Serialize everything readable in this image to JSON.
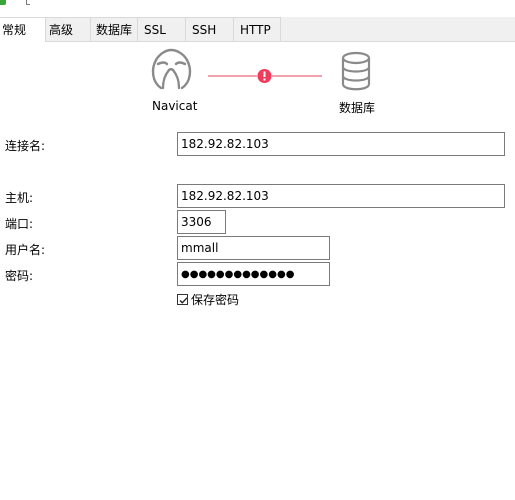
{
  "tabs": [
    {
      "label": "常规",
      "active": true
    },
    {
      "label": "高级",
      "active": false
    },
    {
      "label": "数据库",
      "active": false
    },
    {
      "label": "SSL",
      "active": false
    },
    {
      "label": "SSH",
      "active": false
    },
    {
      "label": "HTTP",
      "active": false
    }
  ],
  "graphic": {
    "client_label": "Navicat",
    "server_label": "数据库",
    "client_icon": "navicat-logo-icon",
    "server_icon": "database-icon",
    "status_icon": "error-icon",
    "link_color": "#f4a0ad",
    "status_color": "#ef3b5c"
  },
  "form": {
    "connection_name": {
      "label": "连接名:",
      "value": "182.92.82.103"
    },
    "host": {
      "label": "主机:",
      "value": "182.92.82.103"
    },
    "port": {
      "label": "端口:",
      "value": "3306"
    },
    "username": {
      "label": "用户名:",
      "value": "mmall"
    },
    "password": {
      "label": "密码:",
      "value": "●●●●●●●●●●●●●"
    },
    "save_password": {
      "label": "保存密码",
      "checked": true
    }
  }
}
